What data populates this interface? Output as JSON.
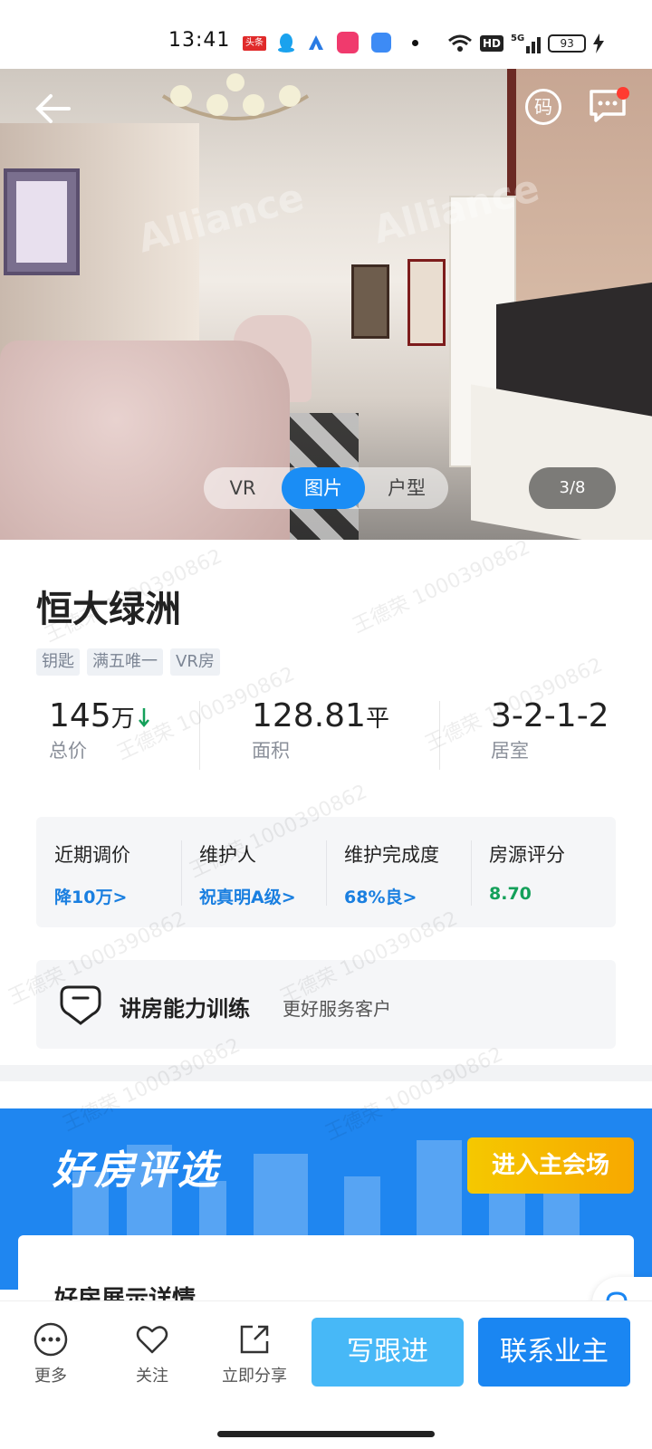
{
  "status_bar": {
    "time": "13:41",
    "news_badge": "头条",
    "network": "HD",
    "signal": "5G",
    "battery": "93"
  },
  "hero": {
    "watermark": "Alliance",
    "code_label": "码",
    "media_tabs": [
      "VR",
      "图片",
      "户型"
    ],
    "active_tab": "图片",
    "page_indicator": "3/8"
  },
  "listing": {
    "title": "恒大绿洲",
    "tags": [
      "钥匙",
      "满五唯一",
      "VR房"
    ],
    "stats": [
      {
        "value": "145",
        "unit": "万",
        "label": "总价"
      },
      {
        "value": "128.81",
        "unit": "平",
        "label": "面积"
      },
      {
        "value": "3-2-1-2",
        "unit": "",
        "label": "居室"
      }
    ]
  },
  "metrics": [
    {
      "label": "近期调价",
      "value": "降10万>"
    },
    {
      "label": "维护人",
      "value": "祝真明A级>"
    },
    {
      "label": "维护完成度",
      "value": "68%良>"
    },
    {
      "label": "房源评分",
      "value": "8.70"
    }
  ],
  "training": {
    "title": "讲房能力训练",
    "subtitle": "更好服务客户"
  },
  "banner": {
    "title": "好房评选",
    "button": "进入主会场",
    "card_title": "好房展示详情"
  },
  "watermark_text": "王德荣 1000390862",
  "bottom_bar": {
    "more": "更多",
    "follow": "关注",
    "share": "立即分享",
    "follow_up": "写跟进",
    "contact": "联系业主"
  },
  "colors": {
    "primary": "#1a86f2",
    "light_primary": "#47b8f7",
    "price_down": "#14a05a",
    "banner_button": "#f5c800"
  }
}
